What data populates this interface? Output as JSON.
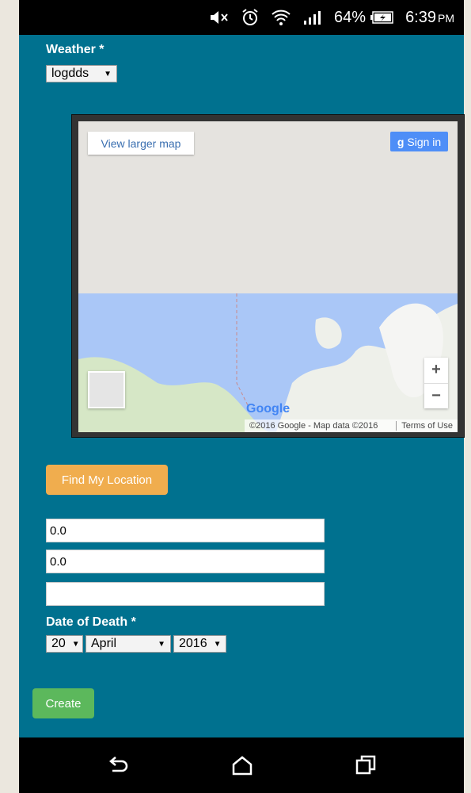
{
  "status_bar": {
    "battery_percent": "64%",
    "time": "6:39",
    "time_suffix": "PM",
    "icons": [
      "mute-icon",
      "alarm-icon",
      "wifi-icon",
      "signal-icon",
      "battery-charging-icon"
    ]
  },
  "form": {
    "weather": {
      "label": "Weather *",
      "selected": "logdds"
    },
    "map": {
      "view_larger_label": "View larger map",
      "sign_in_label": "Sign in",
      "zoom_in": "+",
      "zoom_out": "−",
      "logo_text": "Google",
      "attribution": "©2016 Google - Map data ©2016",
      "terms": "Terms of Use"
    },
    "find_location_label": "Find My Location",
    "latitude_value": "0.0",
    "longitude_value": "0.0",
    "extra_value": "",
    "date_of_death": {
      "label": "Date of Death *",
      "day": "20",
      "month": "April",
      "year": "2016"
    },
    "create_label": "Create"
  },
  "colors": {
    "page_background": "#00718f",
    "find_button": "#f0ad4e",
    "create_button": "#5cb85c",
    "sign_in_button": "#4e8ef7",
    "ocean": "#aac7f7",
    "land": "#e5e3df"
  }
}
